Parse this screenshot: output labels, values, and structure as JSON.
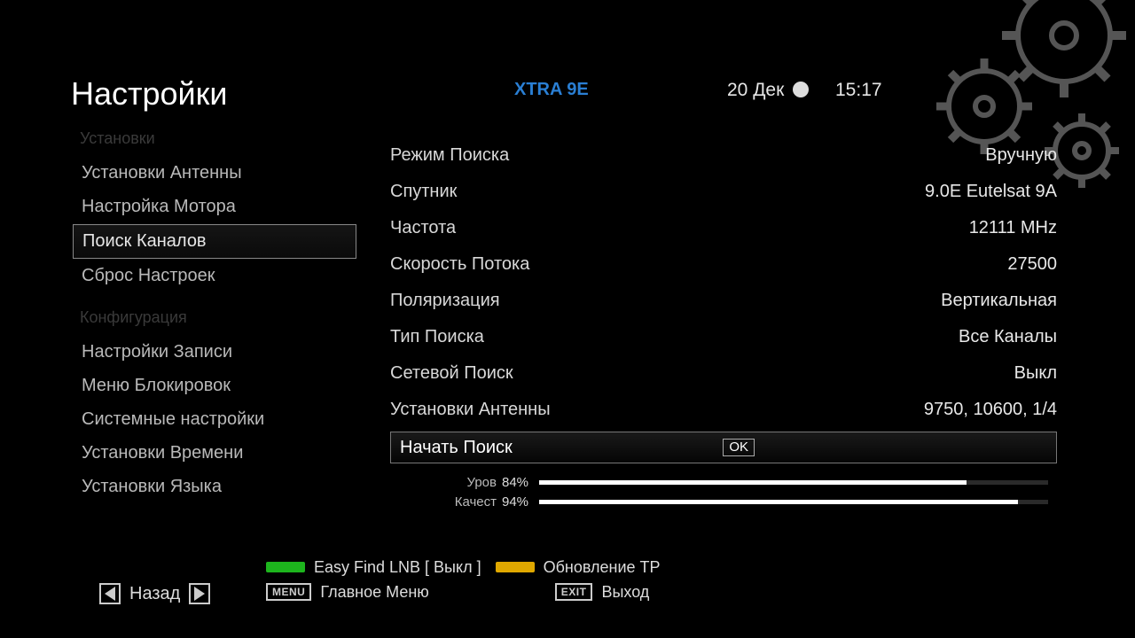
{
  "header": {
    "title": "Настройки",
    "source": "XTRA 9E",
    "date": "20 Дек",
    "time": "15:17"
  },
  "sidebar": {
    "group1": "Установки",
    "group2": "Конфигурация",
    "items1": [
      "Установки Антенны",
      "Настройка Мотора",
      "Поиск Каналов",
      "Сброс Настроек"
    ],
    "items2": [
      "Настройки Записи",
      "Меню Блокировок",
      "Системные настройки",
      "Установки Времени",
      "Установки Языка"
    ],
    "selected_index": 2
  },
  "panel": {
    "rows": [
      {
        "label": "Режим Поиска",
        "value": "Вручную"
      },
      {
        "label": "Спутник",
        "value": "9.0E Eutelsat 9A"
      },
      {
        "label": "Частота",
        "value": "12111 MHz"
      },
      {
        "label": "Скорость Потока",
        "value": "27500"
      },
      {
        "label": "Поляризация",
        "value": "Вертикальная"
      },
      {
        "label": "Тип Поиска",
        "value": "Все Каналы"
      },
      {
        "label": "Сетевой Поиск",
        "value": "Выкл"
      },
      {
        "label": "Установки Антенны",
        "value": "9750, 10600, 1/4"
      }
    ],
    "action": {
      "label": "Начать Поиск",
      "ok": "OK"
    },
    "signal": {
      "level_label": "Уров",
      "level_pct": "84%",
      "level": 84,
      "quality_label": "Качест",
      "quality_pct": "94%",
      "quality": 94
    }
  },
  "footer": {
    "green_label": "Easy Find LNB [ Выкл ]",
    "yellow_label": "Обновление ТР",
    "menu_key": "MENU",
    "menu_label": "Главное Меню",
    "exit_key": "EXIT",
    "exit_label": "Выход",
    "back": "Назад"
  }
}
